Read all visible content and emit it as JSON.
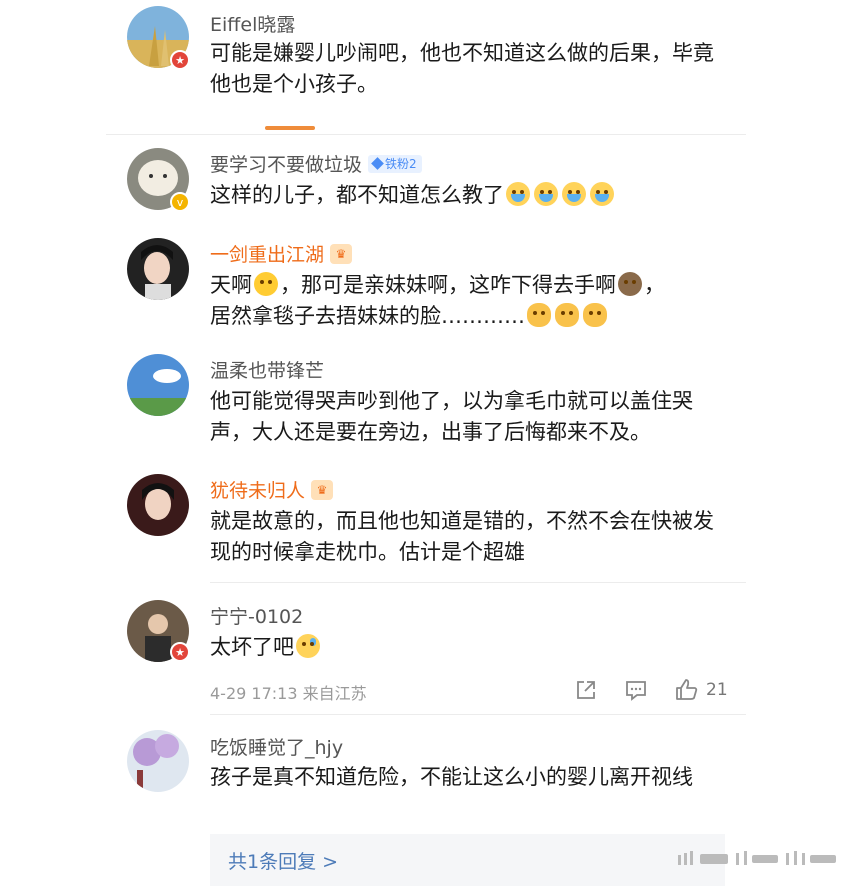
{
  "comments": [
    {
      "user": "Eiffel晓露",
      "text": "可能是嫌婴儿吵闹吧，他也不知道这么做的后果，毕竟他也是个小孩子。"
    },
    {
      "user": "要学习不要做垃圾",
      "badge": "铁粉2",
      "text": "这样的儿子，都不知道怎么教了"
    },
    {
      "user": "一剑重出江湖",
      "text_line1": "天啊",
      "text_line1b": "，那可是亲妹妹啊，这咋下得去手啊",
      "text_line1c": "，",
      "text_line2": "居然拿毯子去捂妹妹的脸…………"
    },
    {
      "user": "温柔也带锋芒",
      "text": "他可能觉得哭声吵到他了，以为拿毛巾就可以盖住哭声，大人还是要在旁边，出事了后悔都来不及。"
    },
    {
      "user": "犹待未归人",
      "text": "就是故意的，而且他也知道是错的，不然不会在快被发现的时候拿走枕巾。估计是个超雄"
    },
    {
      "user": "宁宁-0102",
      "text": "太坏了吧",
      "meta": "4-29 17:13  来自江苏",
      "likes": "21"
    },
    {
      "user": "吃饭睡觉了_hjy",
      "text": "孩子是真不知道危险，不能让这么小的婴儿离开视线",
      "reply_link": "共1条回复 >"
    }
  ],
  "colors": {
    "accent": "#ef6c1a",
    "link": "#4d7bb8",
    "fan_badge": "#4a8cf5"
  },
  "icons": [
    "share-icon",
    "comment-icon",
    "like-icon"
  ]
}
